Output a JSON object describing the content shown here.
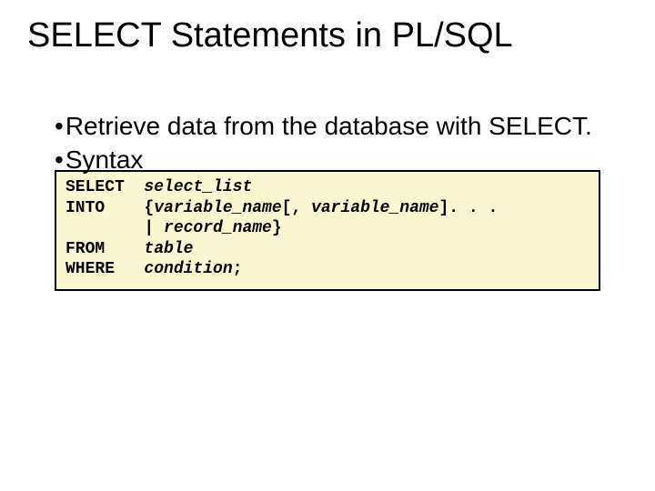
{
  "title": "SELECT Statements in PL/SQL",
  "bullets": {
    "b1": "Retrieve data from the database with SELECT.",
    "b2": "Syntax"
  },
  "code": {
    "l1_kw": "SELECT  ",
    "l1_it": "select_list",
    "l2_kw": "INTO    {",
    "l2_it": "variable_name",
    "l2_mid": "[, ",
    "l2_it2": "variable_name",
    "l2_end": "]. . .",
    "l3_pre": "        | ",
    "l3_it": "record_name",
    "l3_end": "}",
    "l4_kw": "FROM    ",
    "l4_it": "table",
    "l5_kw": "WHERE   ",
    "l5_it": "condition",
    "l5_end": ";"
  }
}
